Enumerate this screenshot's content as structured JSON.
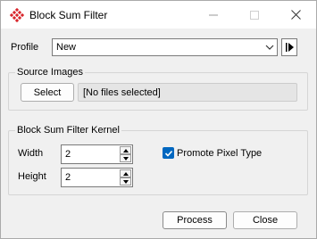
{
  "window": {
    "title": "Block Sum Filter"
  },
  "profile": {
    "label": "Profile",
    "value": "New"
  },
  "source_images": {
    "group_title": "Source Images",
    "select_label": "Select",
    "files_text": "[No files selected]"
  },
  "kernel": {
    "group_title": "Block Sum Filter Kernel",
    "width_label": "Width",
    "width_value": "2",
    "height_label": "Height",
    "height_value": "2",
    "promote_label": "Promote Pixel Type",
    "promote_checked": true
  },
  "actions": {
    "process_label": "Process",
    "close_label": "Close"
  },
  "colors": {
    "accent": "#0067c0",
    "icon_red": "#d9262c"
  }
}
